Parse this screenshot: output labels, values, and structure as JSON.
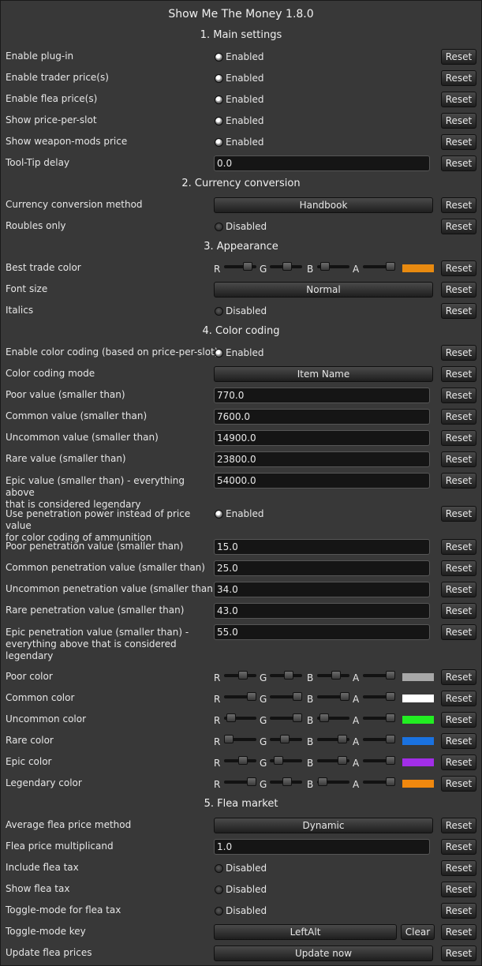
{
  "title": "Show Me The Money 1.8.0",
  "reset_label": "Reset",
  "clear_label": "Clear",
  "on_text": "Enabled",
  "off_text": "Disabled",
  "channels": [
    "R",
    "G",
    "B",
    "A"
  ],
  "sections": {
    "main": "1. Main settings",
    "currency": "2. Currency conversion",
    "appearance": "3. Appearance",
    "color_coding": "4. Color coding",
    "flea": "5. Flea market"
  },
  "settings": {
    "enable_plugin": {
      "label": "Enable plug-in",
      "enabled": true
    },
    "enable_trader_price": {
      "label": "Enable trader price(s)",
      "enabled": true
    },
    "enable_flea_price": {
      "label": "Enable flea price(s)",
      "enabled": true
    },
    "show_price_per_slot": {
      "label": "Show price-per-slot",
      "enabled": true
    },
    "show_weapon_mods_price": {
      "label": "Show weapon-mods price",
      "enabled": true
    },
    "tooltip_delay": {
      "label": "Tool-Tip delay",
      "value": "0.0"
    },
    "currency_conversion_method": {
      "label": "Currency conversion method",
      "value": "Handbook"
    },
    "roubles_only": {
      "label": "Roubles only",
      "enabled": false
    },
    "best_trade_color": {
      "label": "Best trade color",
      "color": "#e88a10",
      "rgba": [
        0.82,
        0.56,
        0.15,
        1.0
      ]
    },
    "font_size": {
      "label": "Font size",
      "value": "Normal"
    },
    "italics": {
      "label": "Italics",
      "enabled": false
    },
    "enable_color_coding": {
      "label": "Enable color coding (based on price-per-slot)",
      "enabled": true
    },
    "color_coding_mode": {
      "label": "Color coding mode",
      "value": "Item Name"
    },
    "poor_value": {
      "label": "Poor value (smaller than)",
      "value": "770.0"
    },
    "common_value": {
      "label": "Common value (smaller than)",
      "value": "7600.0"
    },
    "uncommon_value": {
      "label": "Uncommon value (smaller than)",
      "value": "14900.0"
    },
    "rare_value": {
      "label": "Rare value (smaller than)",
      "value": "23800.0"
    },
    "epic_value": {
      "label": "Epic value (smaller than) - everything above\nthat is considered legendary",
      "value": "54000.0"
    },
    "use_penetration_power": {
      "label": "Use penetration power instead of price value\nfor color coding of ammunition",
      "enabled": true
    },
    "poor_penetration": {
      "label": "Poor penetration value (smaller than)",
      "value": "15.0"
    },
    "common_penetration": {
      "label": "Common penetration value (smaller than)",
      "value": "25.0"
    },
    "uncommon_penetration": {
      "label": "Uncommon penetration value (smaller than)",
      "value": "34.0"
    },
    "rare_penetration": {
      "label": "Rare penetration value (smaller than)",
      "value": "43.0"
    },
    "epic_penetration": {
      "label": "Epic penetration value (smaller than) -\neverything above that is considered\nlegendary",
      "value": "55.0"
    },
    "poor_color": {
      "label": "Poor color",
      "color": "#a8a8a8",
      "rgba": [
        0.63,
        0.63,
        0.63,
        1.0
      ]
    },
    "common_color": {
      "label": "Common color",
      "color": "#ffffff",
      "rgba": [
        1.0,
        1.0,
        1.0,
        1.0
      ]
    },
    "uncommon_color": {
      "label": "Uncommon color",
      "color": "#22ee22",
      "rgba": [
        0.12,
        1.0,
        0.12,
        1.0
      ]
    },
    "rare_color": {
      "label": "Rare color",
      "color": "#1a72e0",
      "rgba": [
        0.0,
        0.45,
        0.9,
        1.0
      ]
    },
    "epic_color": {
      "label": "Epic color",
      "color": "#a22ee8",
      "rgba": [
        0.63,
        0.17,
        0.9,
        1.0
      ]
    },
    "legendary_color": {
      "label": "Legendary color",
      "color": "#f0880e",
      "rgba": [
        1.0,
        0.56,
        0.05,
        1.0
      ]
    },
    "average_flea_price_method": {
      "label": "Average flea price method",
      "value": "Dynamic"
    },
    "flea_price_multiplicand": {
      "label": "Flea price multiplicand",
      "value": "1.0"
    },
    "include_flea_tax": {
      "label": "Include flea tax",
      "enabled": false
    },
    "show_flea_tax": {
      "label": "Show flea tax",
      "enabled": false
    },
    "toggle_mode_flea_tax": {
      "label": "Toggle-mode for flea tax",
      "enabled": false
    },
    "toggle_mode_key": {
      "label": "Toggle-mode key",
      "value": "LeftAlt"
    },
    "update_flea_prices": {
      "label": "Update flea prices",
      "value": "Update now"
    }
  }
}
